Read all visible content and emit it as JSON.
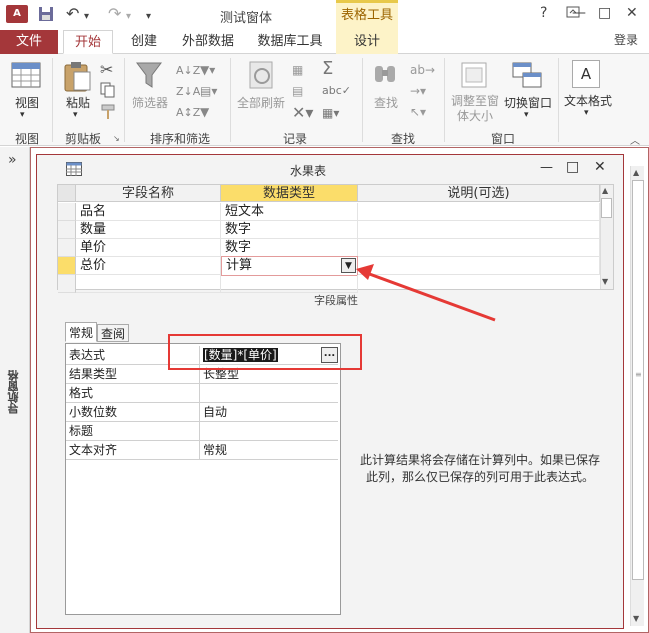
{
  "titlebar": {
    "app_icon": "A",
    "title": "测试窗体",
    "tool_tab_title": "表格工具",
    "help": "?",
    "minimize": "—",
    "restore": "□",
    "close": "✕",
    "undo": "↶",
    "redo": "↷",
    "save": "💾",
    "qat_more": "▾"
  },
  "tabs": {
    "file": "文件",
    "home": "开始",
    "create": "创建",
    "external": "外部数据",
    "dbtools": "数据库工具",
    "design": "设计",
    "login": "登录"
  },
  "ribbon": {
    "views": {
      "label": "视图",
      "group": "视图"
    },
    "clipboard": {
      "paste": "粘贴",
      "group": "剪贴板"
    },
    "sort": {
      "filter": "筛选器",
      "group": "排序和筛选"
    },
    "records": {
      "refresh": "全部刷新",
      "group": "记录"
    },
    "find": {
      "find": "查找",
      "group": "查找"
    },
    "window": {
      "fit": "调整至窗体大小",
      "switch": "切换窗口",
      "group": "窗口"
    },
    "text": {
      "format": "文本格式",
      "letter": "A"
    }
  },
  "nav": {
    "label": "导航窗格",
    "chevron": "»"
  },
  "doc": {
    "title": "水果表",
    "min": "—",
    "max": "□",
    "close": "✕"
  },
  "grid": {
    "headers": [
      "字段名称",
      "数据类型",
      "说明(可选)"
    ],
    "rows": [
      {
        "name": "品名",
        "type": "短文本"
      },
      {
        "name": "数量",
        "type": "数字"
      },
      {
        "name": "单价",
        "type": "数字"
      },
      {
        "name": "总价",
        "type": "计算"
      }
    ]
  },
  "props": {
    "heading": "字段属性",
    "tabs": [
      "常规",
      "查阅"
    ],
    "rows": [
      {
        "label": "表达式",
        "value": "[数量]*[单价]"
      },
      {
        "label": "结果类型",
        "value": "长整型"
      },
      {
        "label": "格式",
        "value": ""
      },
      {
        "label": "小数位数",
        "value": "自动"
      },
      {
        "label": "标题",
        "value": ""
      },
      {
        "label": "文本对齐",
        "value": "常规"
      }
    ],
    "builder": "...",
    "hint": "此计算结果将会存储在计算列中。如果已保存此列，那么仅已保存的列可用于此表达式。"
  },
  "colors": {
    "accent": "#a4373a",
    "highlight": "#fbdd6a",
    "annotation": "#e53935"
  }
}
